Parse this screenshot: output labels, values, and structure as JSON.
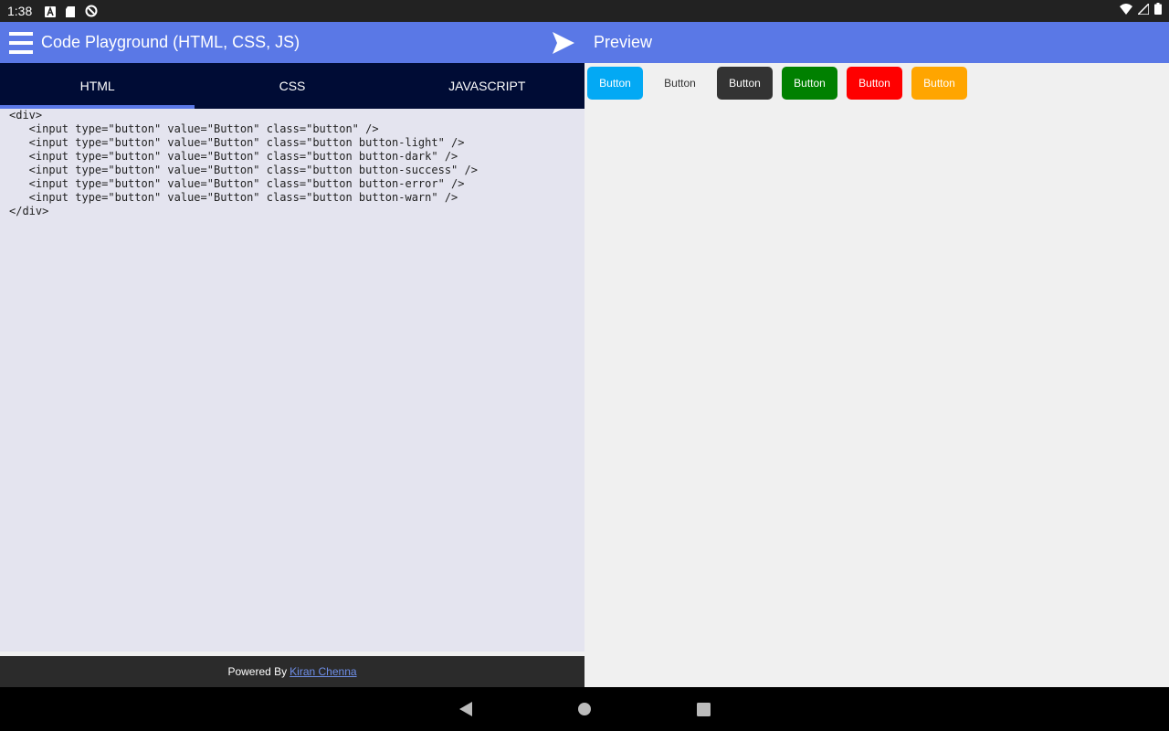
{
  "status": {
    "time": "1:38"
  },
  "toolbar": {
    "title": "Code Playground (HTML, CSS, JS)",
    "preview_title": "Preview"
  },
  "tabs": [
    {
      "label": "HTML",
      "active": true
    },
    {
      "label": "CSS",
      "active": false
    },
    {
      "label": "JAVASCRIPT",
      "active": false
    }
  ],
  "editor": {
    "code": "<div>\n   <input type=\"button\" value=\"Button\" class=\"button\" />\n   <input type=\"button\" value=\"Button\" class=\"button button-light\" />\n   <input type=\"button\" value=\"Button\" class=\"button button-dark\" />\n   <input type=\"button\" value=\"Button\" class=\"button button-success\" />\n   <input type=\"button\" value=\"Button\" class=\"button button-error\" />\n   <input type=\"button\" value=\"Button\" class=\"button button-warn\" />\n</div>"
  },
  "footer": {
    "prefix": "Powered By",
    "link_text": "Kiran Chenna"
  },
  "preview": {
    "buttons": [
      {
        "label": "Button",
        "bg": "#03a9f4",
        "fg": "#ffffff"
      },
      {
        "label": "Button",
        "bg": "#f0f0f0",
        "fg": "#333333"
      },
      {
        "label": "Button",
        "bg": "#333333",
        "fg": "#ffffff"
      },
      {
        "label": "Button",
        "bg": "#008000",
        "fg": "#ffffff"
      },
      {
        "label": "Button",
        "bg": "#ff0000",
        "fg": "#ffffff"
      },
      {
        "label": "Button",
        "bg": "#ffa500",
        "fg": "#ffffff"
      }
    ]
  },
  "colors": {
    "accent": "#5a78e6",
    "tab_bar": "#000c35",
    "editor_bg": "#e4e4ef"
  }
}
